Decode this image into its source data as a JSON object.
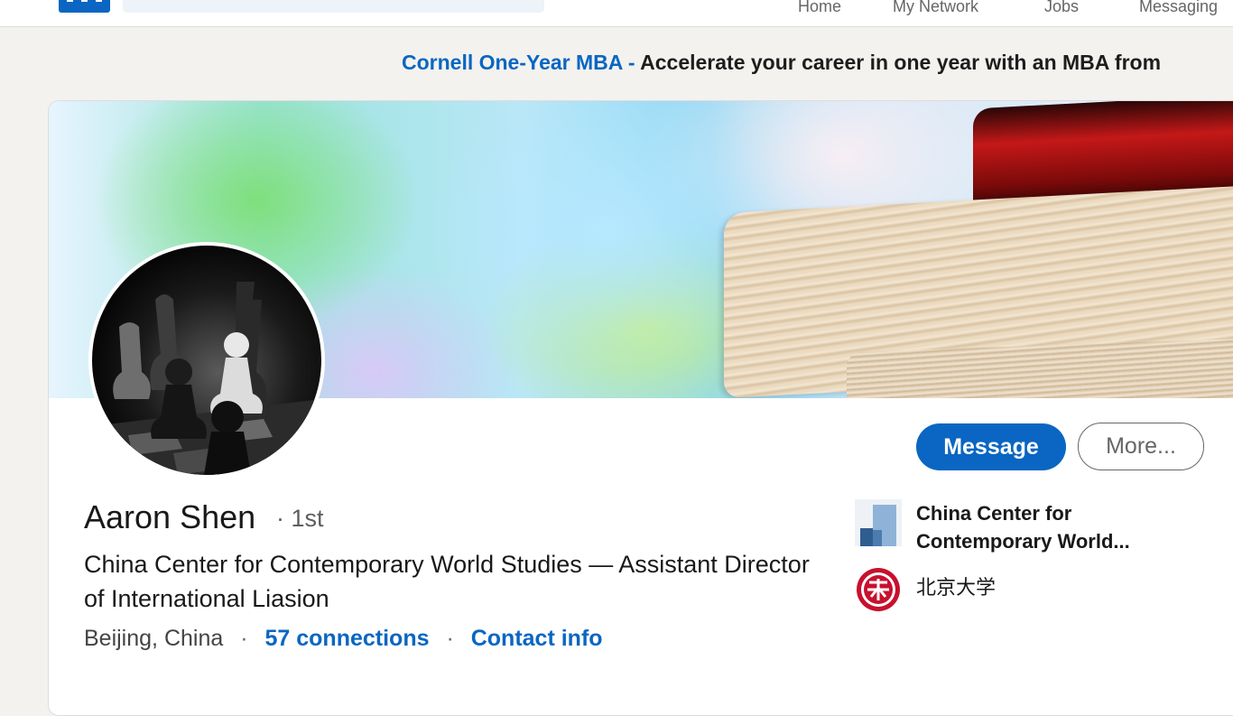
{
  "nav": {
    "items": [
      "Home",
      "My Network",
      "Jobs",
      "Messaging"
    ]
  },
  "promo": {
    "brand": "Cornell One-Year MBA -",
    "text": "Accelerate your career in one year with an MBA from"
  },
  "profile": {
    "name": "Aaron Shen",
    "degree": "· 1st",
    "headline": "China Center for Contemporary World Studies — Assistant Director of International Liasion",
    "location": "Beijing, China",
    "connections": "57 connections",
    "contact": "Contact info",
    "separator": "·"
  },
  "actions": {
    "message": "Message",
    "more": "More..."
  },
  "experience": [
    {
      "name": "China Center for Contemporary World...",
      "line1": "China Center for",
      "line2": "Contemporary World..."
    },
    {
      "name": "北京大学"
    }
  ],
  "colors": {
    "brand": "#0a66c2",
    "background": "#f3f2ef"
  }
}
